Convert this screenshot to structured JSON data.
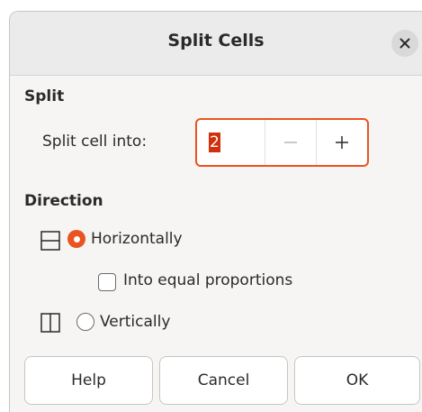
{
  "dialog": {
    "title": "Split Cells"
  },
  "icons": {
    "close": "close-icon",
    "horizontal_split": "split-horizontal-icon",
    "vertical_split": "split-vertical-icon"
  },
  "split": {
    "heading": "Split",
    "label": "Split cell into:",
    "value": "2",
    "minus_label": "−",
    "plus_label": "+"
  },
  "direction": {
    "heading": "Direction",
    "horizontally": {
      "label": "Horizontally",
      "checked": true
    },
    "equal_proportions": {
      "label": "Into equal proportions",
      "checked": false
    },
    "vertically": {
      "label": "Vertically",
      "checked": false
    }
  },
  "buttons": {
    "help": "Help",
    "cancel": "Cancel",
    "ok": "OK"
  },
  "colors": {
    "accent": "#e95420",
    "selection": "#d0300e"
  }
}
